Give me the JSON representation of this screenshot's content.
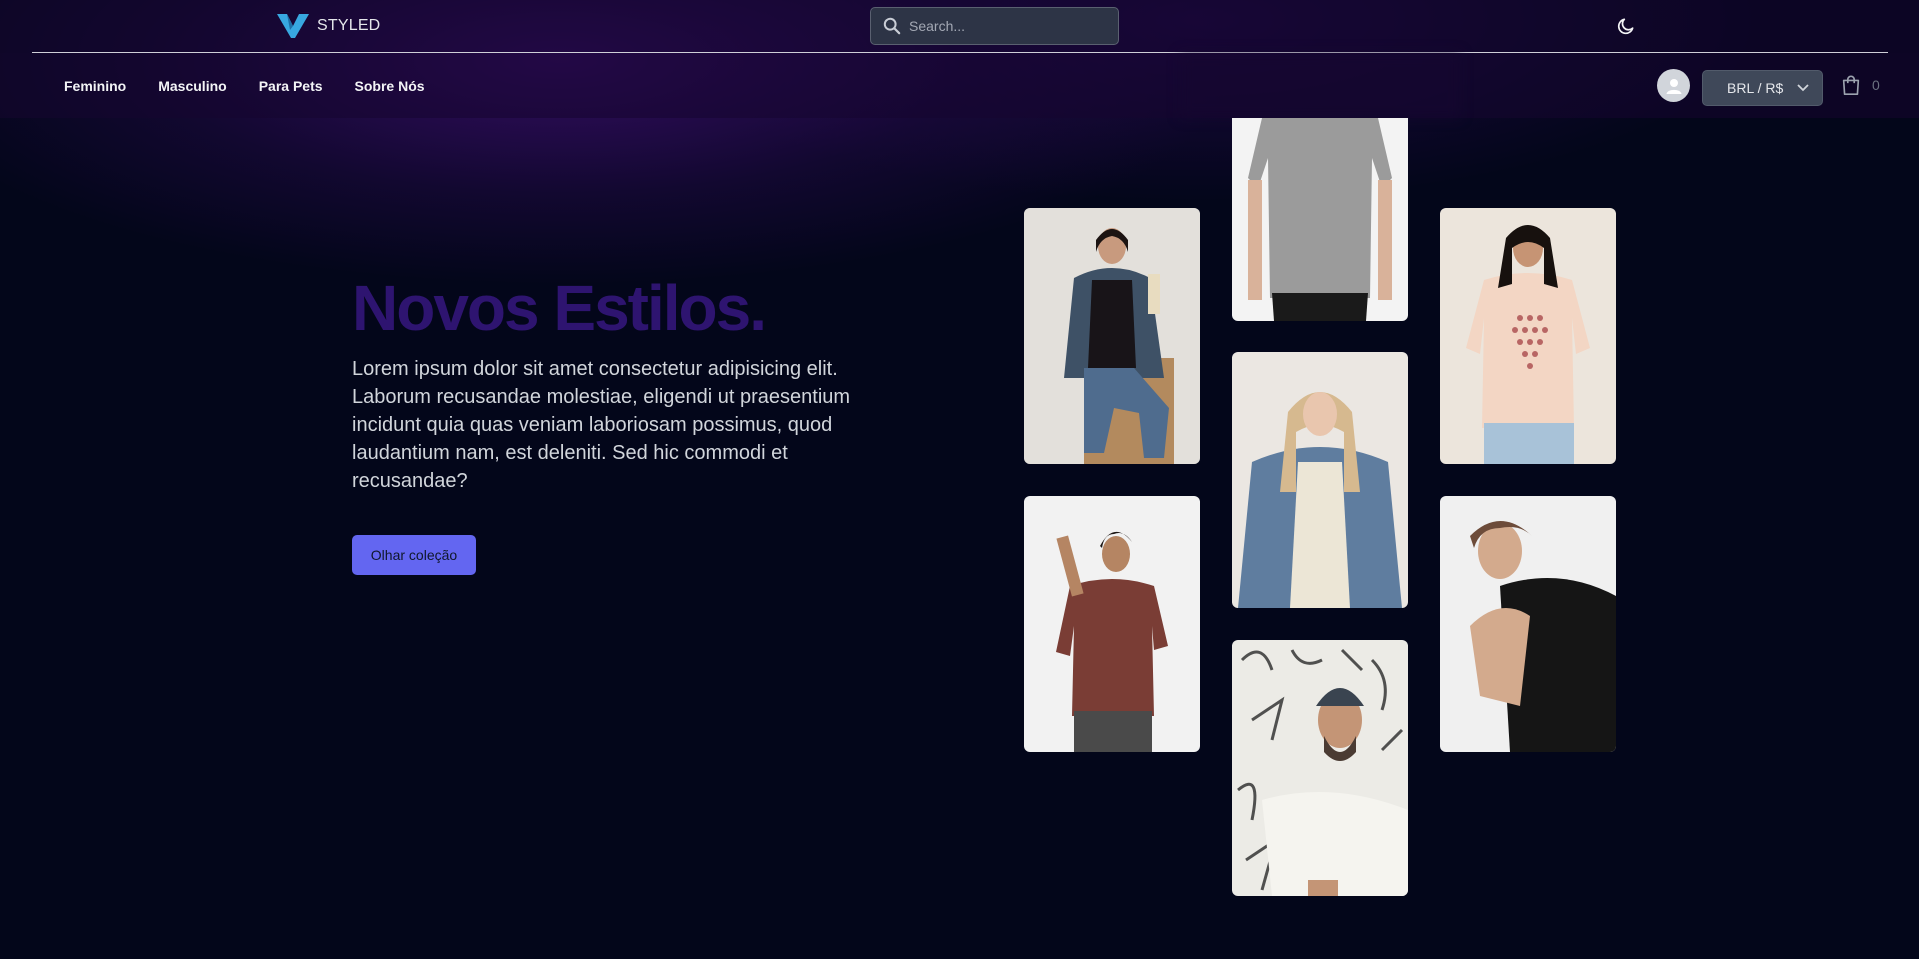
{
  "header": {
    "logo_text": "STYLED",
    "search_placeholder": "Search...",
    "theme_toggle_icon": "moon-icon"
  },
  "nav": {
    "links": [
      "Feminino",
      "Masculino",
      "Para Pets",
      "Sobre Nós"
    ],
    "currency_label": "BRL / R$",
    "cart_count": "0"
  },
  "hero": {
    "title": "Novos Estilos.",
    "text": "Lorem ipsum dolor sit amet consectetur adipisicing elit. Laborum recusandae molestiae, eligendi ut praesentium incidunt quia quas veniam laboriosam possimus, quod laudantium nam, est deleniti. Sed hic commodi et recusandae?",
    "cta_label": "Olhar coleção"
  },
  "colors": {
    "background": "#03061a",
    "accent": "#6366f1",
    "title": "#2e1470"
  },
  "gallery": {
    "images": [
      "woman-denim-jacket-black-tee",
      "man-grey-tee",
      "woman-peach-graphic-tee",
      "woman-blonde-denim-jacket",
      "man-curly-hair-brown-tee",
      "man-black-tee",
      "man-beanie-white-tee"
    ]
  }
}
